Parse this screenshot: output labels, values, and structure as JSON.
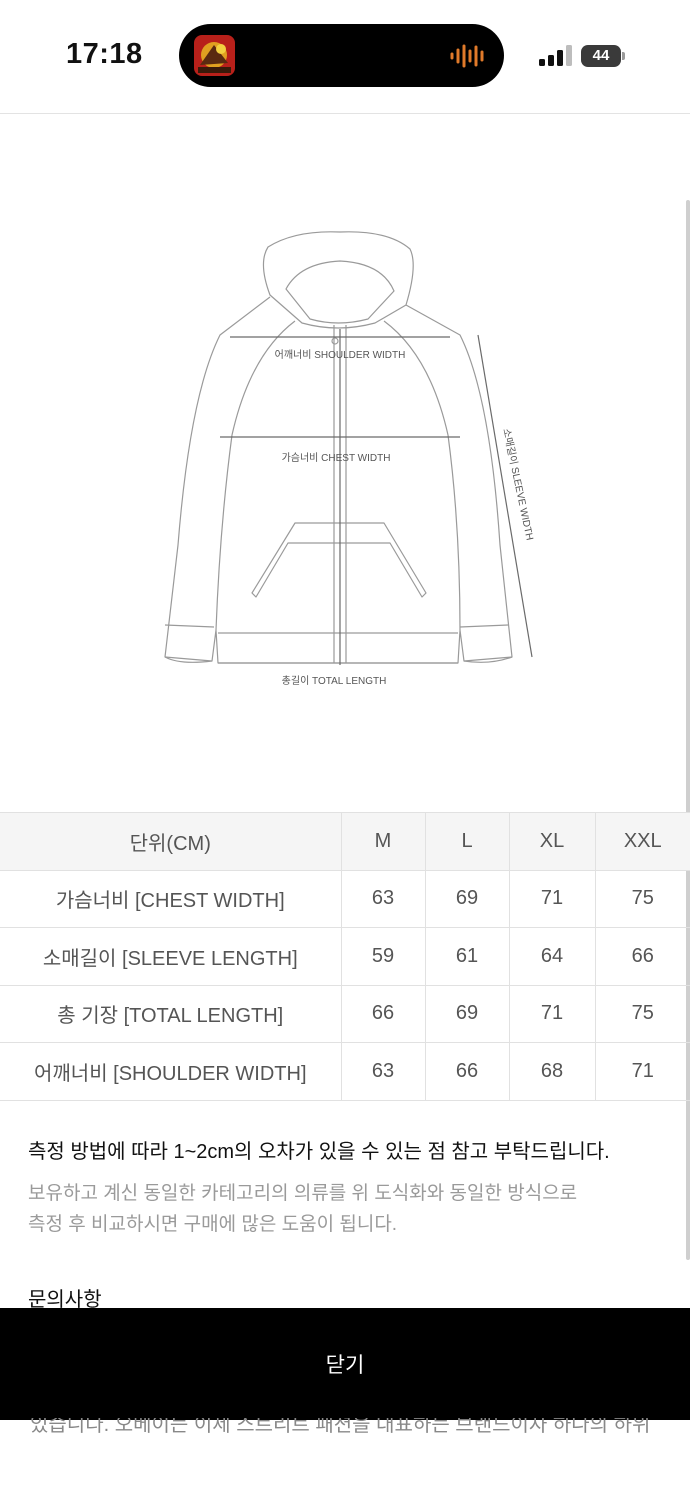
{
  "status_bar": {
    "time": "17:18",
    "battery": "44",
    "icons": [
      "album-art-icon",
      "audio-waveform-icon",
      "cellular-signal-icon",
      "battery-icon"
    ]
  },
  "diagram": {
    "shoulder_label": "어깨너비 SHOULDER WIDTH",
    "chest_label": "가슴너비 CHEST WIDTH",
    "sleeve_label": "소매길이 SLEEVE WIDTH",
    "total_label": "총길이 TOTAL LENGTH"
  },
  "size_table": {
    "header": [
      "단위(CM)",
      "M",
      "L",
      "XL",
      "XXL"
    ],
    "rows": [
      [
        "가슴너비 [CHEST WIDTH]",
        "63",
        "69",
        "71",
        "75"
      ],
      [
        "소매길이 [SLEEVE LENGTH]",
        "59",
        "61",
        "64",
        "66"
      ],
      [
        "총 기장 [TOTAL LENGTH]",
        "66",
        "69",
        "71",
        "75"
      ],
      [
        "어깨너비 [SHOULDER WIDTH]",
        "63",
        "66",
        "68",
        "71"
      ]
    ]
  },
  "notes": {
    "main": "측정 방법에 따라 1~2cm의 오차가 있을 수 있는 점 참고 부탁드립니다.",
    "sub_line1": "보유하고 계신 동일한 카테고리의 의류를 위 도식화와 동일한 방식으로",
    "sub_line2": "측정 후 비교하시면 구매에 많은 도움이 됩니다.",
    "inquiry_title": "문의사항"
  },
  "close_button": {
    "label": "닫기"
  },
  "peek_text": "있습니다. 오베이는 이제 스트리트 패션을 대표하는 브랜드이자 하나의 하위"
}
